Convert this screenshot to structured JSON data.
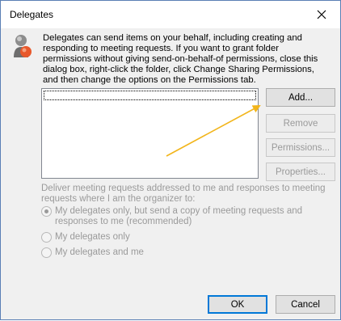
{
  "window": {
    "title": "Delegates",
    "close_icon": "close-icon",
    "accent_color": "#0078d7"
  },
  "intro": {
    "icon": "delegates-person-icon",
    "lines": [
      "Delegates can send items on your behalf, including creating and",
      "responding to meeting requests. If you want to grant folder",
      "permissions without giving send-on-behalf-of permissions, close this",
      "dialog box, right-click the folder, click Change Sharing Permissions,",
      "and then change the options on the Permissions tab."
    ]
  },
  "buttons": {
    "add": "Add...",
    "remove": "Remove",
    "permissions": "Permissions...",
    "properties": "Properties...",
    "ok": "OK",
    "cancel": "Cancel"
  },
  "meeting_requests": {
    "label_lines": [
      "Deliver meeting requests addressed to me and responses to meeting",
      "requests where I am the organizer to:"
    ],
    "options": [
      {
        "lines": [
          "My delegates only, but send a copy of meeting requests and",
          "responses to me (recommended)"
        ],
        "selected": true
      },
      {
        "lines": [
          "My delegates only"
        ],
        "selected": false
      },
      {
        "lines": [
          "My delegates and me"
        ],
        "selected": false
      }
    ]
  },
  "annotation": {
    "arrow_color": "#f2b51b"
  }
}
